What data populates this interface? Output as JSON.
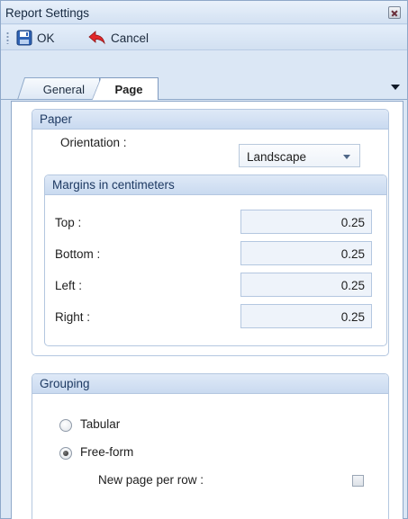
{
  "window": {
    "title": "Report Settings"
  },
  "toolbar": {
    "ok_label": "OK",
    "cancel_label": "Cancel"
  },
  "tabs": [
    {
      "label": "General",
      "active": false
    },
    {
      "label": "Page",
      "active": true
    }
  ],
  "paper": {
    "header": "Paper",
    "orientation_label": "Orientation :",
    "orientation_value": "Landscape",
    "margins": {
      "header": "Margins in centimeters",
      "fields": [
        {
          "label": "Top :",
          "value": "0.25"
        },
        {
          "label": "Bottom :",
          "value": "0.25"
        },
        {
          "label": "Left :",
          "value": "0.25"
        },
        {
          "label": "Right :",
          "value": "0.25"
        }
      ]
    }
  },
  "grouping": {
    "header": "Grouping",
    "options": [
      {
        "label": "Tabular",
        "selected": false
      },
      {
        "label": "Free-form",
        "selected": true
      }
    ],
    "new_page_label": "New page per row :",
    "new_page_checked": false
  },
  "icons": {
    "ok": "save-icon",
    "cancel": "back-arrow-icon",
    "close": "close-icon"
  },
  "colors": {
    "accent": "#c9daf0",
    "border": "#8ea8c9",
    "header_text": "#1e3a63"
  }
}
